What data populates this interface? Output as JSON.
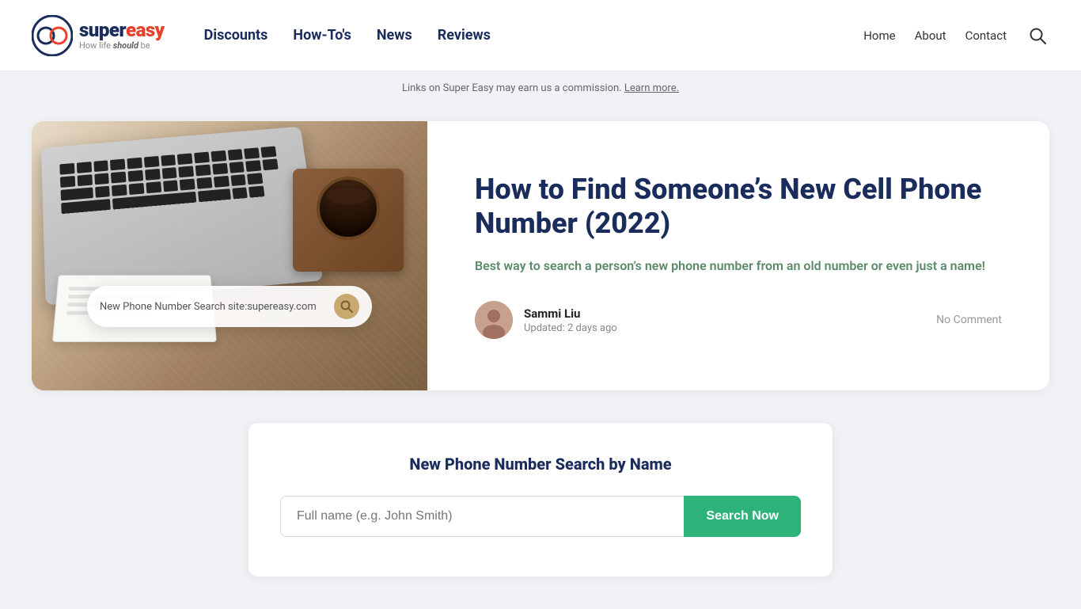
{
  "header": {
    "logo_super": "super",
    "logo_easy": "easy",
    "logo_tagline_prefix": "How life ",
    "logo_tagline_emphasis": "should",
    "logo_tagline_suffix": " be",
    "nav": [
      {
        "label": "Discounts",
        "href": "#"
      },
      {
        "label": "How-To's",
        "href": "#"
      },
      {
        "label": "News",
        "href": "#"
      },
      {
        "label": "Reviews",
        "href": "#"
      }
    ],
    "right_links": [
      {
        "label": "Home",
        "href": "#"
      },
      {
        "label": "About",
        "href": "#"
      },
      {
        "label": "Contact",
        "href": "#"
      }
    ]
  },
  "commission_bar": {
    "text": "Links on Super Easy may earn us a commission.",
    "learn_more": "Learn more."
  },
  "article": {
    "title": "How to Find Someone’s New Cell Phone Number (2022)",
    "subtitle": "Best way to search a person’s new phone number from an old number or even just a name!",
    "author_name": "Sammi Liu",
    "updated": "Updated: 2 days ago",
    "comment_count": "No Comment",
    "hero_search_text": "New Phone Number Search site:supereasy.com"
  },
  "search_widget": {
    "title": "New Phone Number Search by Name",
    "input_placeholder": "Full name (e.g. John Smith)",
    "button_label": "Search Now"
  },
  "icons": {
    "search": "🔍",
    "search_unicode": "⌕"
  }
}
